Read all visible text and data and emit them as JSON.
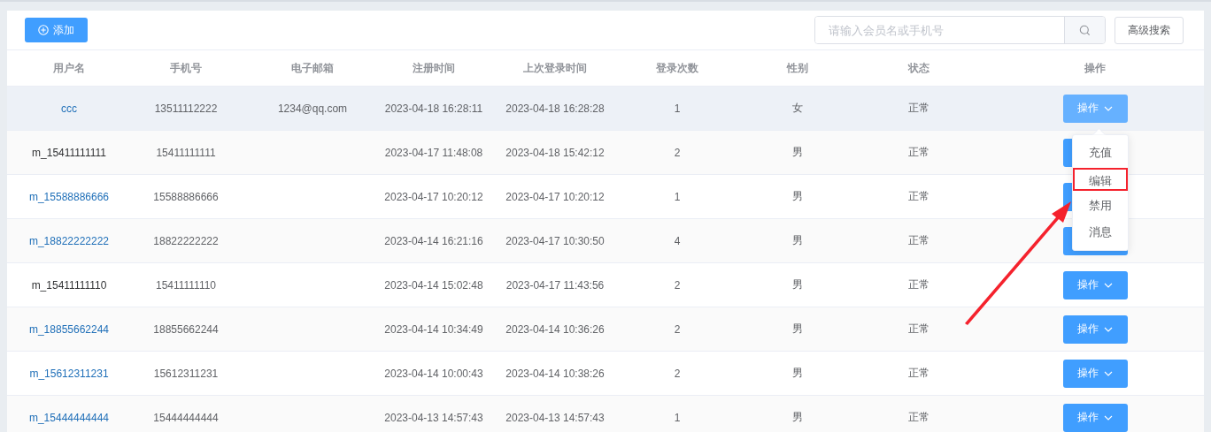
{
  "toolbar": {
    "add_button": "添加",
    "search": {
      "placeholder": "请输入会员名或手机号"
    },
    "advanced_button": "高级搜索"
  },
  "table": {
    "columns": [
      "用户名",
      "手机号",
      "电子邮箱",
      "注册时间",
      "上次登录时间",
      "登录次数",
      "性别",
      "状态",
      "操作"
    ],
    "rows": [
      {
        "username": "ccc",
        "linked": true,
        "hovered": true,
        "phone": "13511112222",
        "email": "1234@qq.com",
        "registered": "2023-04-18 16:28:11",
        "last_login": "2023-04-18 16:28:28",
        "logins": "1",
        "gender": "女",
        "status": "正常",
        "action": "操作"
      },
      {
        "username": "m_15411111111",
        "linked": false,
        "hovered": false,
        "phone": "15411111111",
        "registered": "2023-04-17 11:48:08",
        "last_login": "2023-04-18 15:42:12",
        "logins": "2",
        "gender": "男",
        "status": "正常"
      },
      {
        "username": "m_15588886666",
        "linked": true,
        "hovered": false,
        "phone": "15588886666",
        "registered": "2023-04-17 10:20:12",
        "last_login": "2023-04-17 10:20:12",
        "logins": "1",
        "gender": "男",
        "status": "正常"
      },
      {
        "username": "m_18822222222",
        "linked": true,
        "hovered": false,
        "phone": "18822222222",
        "registered": "2023-04-14 16:21:16",
        "last_login": "2023-04-17 10:30:50",
        "logins": "4",
        "gender": "男",
        "status": "正常"
      },
      {
        "username": "m_15411111110",
        "linked": false,
        "hovered": false,
        "phone": "15411111110",
        "registered": "2023-04-14 15:02:48",
        "last_login": "2023-04-17 11:43:56",
        "logins": "2",
        "gender": "男",
        "status": "正常",
        "action": "操作"
      },
      {
        "username": "m_18855662244",
        "linked": true,
        "hovered": false,
        "phone": "18855662244",
        "registered": "2023-04-14 10:34:49",
        "last_login": "2023-04-14 10:36:26",
        "logins": "2",
        "gender": "男",
        "status": "正常",
        "action": "操作"
      },
      {
        "username": "m_15612311231",
        "linked": true,
        "hovered": false,
        "phone": "15612311231",
        "registered": "2023-04-14 10:00:43",
        "last_login": "2023-04-14 10:38:26",
        "logins": "2",
        "gender": "男",
        "status": "正常",
        "action": "操作"
      },
      {
        "username": "m_15444444444",
        "linked": true,
        "hovered": false,
        "phone": "15444444444",
        "registered": "2023-04-13 14:57:43",
        "last_login": "2023-04-13 14:57:43",
        "logins": "1",
        "gender": "男",
        "status": "正常",
        "action": "操作"
      }
    ]
  },
  "dropdown": {
    "items": [
      {
        "label": "充值",
        "highlighted": false
      },
      {
        "label": "编辑",
        "highlighted": true
      },
      {
        "label": "禁用",
        "highlighted": false
      },
      {
        "label": "消息",
        "highlighted": false
      }
    ]
  }
}
